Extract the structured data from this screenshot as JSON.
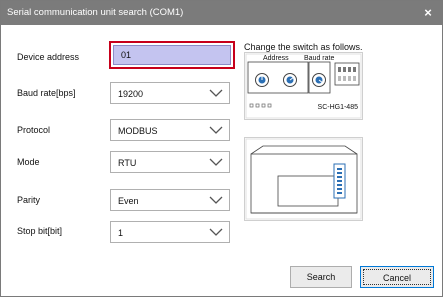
{
  "window": {
    "title": "Serial communication unit search (COM1)",
    "close_icon": "×"
  },
  "form": {
    "device_address": {
      "label": "Device address",
      "value": "01"
    },
    "baud_rate": {
      "label": "Baud rate[bps]",
      "value": "19200"
    },
    "protocol": {
      "label": "Protocol",
      "value": "MODBUS"
    },
    "mode": {
      "label": "Mode",
      "value": "RTU"
    },
    "parity": {
      "label": "Parity",
      "value": "Even"
    },
    "stop_bit": {
      "label": "Stop bit[bit]",
      "value": "1"
    }
  },
  "diagram": {
    "hint": "Change the switch as follows.",
    "address_label": "Address",
    "baud_label": "Baud rate",
    "model_label": "SC-HG1-485"
  },
  "buttons": {
    "search": "Search",
    "cancel": "Cancel"
  },
  "colors": {
    "title_bar": "#7b7b7b",
    "highlight_border": "#c7001b",
    "input_fill": "#c4c4f0"
  }
}
